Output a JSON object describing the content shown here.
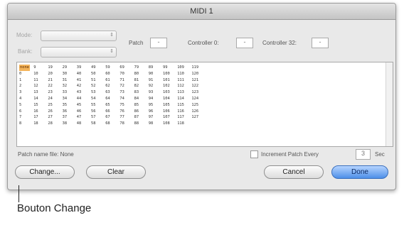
{
  "window": {
    "title": "MIDI 1"
  },
  "top": {
    "mode_label": "Mode:",
    "bank_label": "Bank:",
    "patch_label": "Patch",
    "patch_value": "-",
    "controller0_label": "Controller 0:",
    "controller0_value": "-",
    "controller32_label": "Controller 32:",
    "controller32_value": "-"
  },
  "patch_grid": {
    "selected": "none",
    "columns": [
      [
        "none",
        "0",
        "1",
        "2",
        "3",
        "4",
        "5",
        "6",
        "7",
        "8"
      ],
      [
        "9",
        "10",
        "11",
        "12",
        "13",
        "14",
        "15",
        "16",
        "17",
        "18"
      ],
      [
        "19",
        "20",
        "21",
        "22",
        "23",
        "24",
        "25",
        "26",
        "27",
        "28"
      ],
      [
        "29",
        "30",
        "31",
        "32",
        "33",
        "34",
        "35",
        "36",
        "37",
        "38"
      ],
      [
        "39",
        "40",
        "41",
        "42",
        "43",
        "44",
        "45",
        "46",
        "47",
        "48"
      ],
      [
        "49",
        "50",
        "51",
        "52",
        "53",
        "54",
        "55",
        "56",
        "57",
        "58"
      ],
      [
        "59",
        "60",
        "61",
        "62",
        "63",
        "64",
        "65",
        "66",
        "67",
        "68"
      ],
      [
        "69",
        "70",
        "71",
        "72",
        "73",
        "74",
        "75",
        "76",
        "77",
        "78"
      ],
      [
        "79",
        "80",
        "81",
        "82",
        "83",
        "84",
        "85",
        "86",
        "87",
        "88"
      ],
      [
        "89",
        "90",
        "91",
        "92",
        "93",
        "94",
        "95",
        "96",
        "97",
        "98"
      ],
      [
        "99",
        "100",
        "101",
        "102",
        "103",
        "104",
        "105",
        "106",
        "107",
        "108"
      ],
      [
        "109",
        "110",
        "111",
        "112",
        "113",
        "114",
        "115",
        "116",
        "117",
        "118"
      ],
      [
        "119",
        "120",
        "121",
        "122",
        "123",
        "124",
        "125",
        "126",
        "127"
      ]
    ]
  },
  "bottom": {
    "patch_file_label": "Patch name file: None",
    "increment_label": "Increment Patch Every",
    "increment_value": "3",
    "sec_label": "Sec"
  },
  "buttons": {
    "change": "Change...",
    "clear": "Clear",
    "cancel": "Cancel",
    "done": "Done"
  },
  "annotation": {
    "text": "Bouton Change"
  }
}
